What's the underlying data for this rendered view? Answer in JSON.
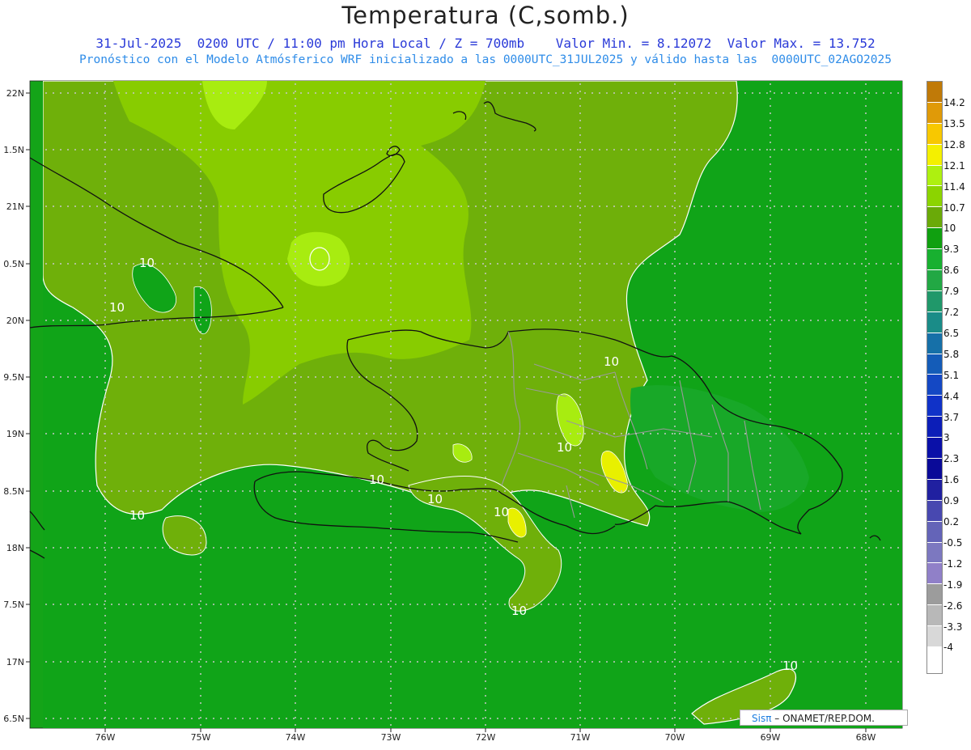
{
  "title": "Temperatura (C,somb.)",
  "subtitle1": "31-Jul-2025  0200 UTC / 11:00 pm Hora Local / Z = 700mb    Valor Min. = 8.12072  Valor Max. = 13.752",
  "subtitle2": "Pronóstico con el Modelo Atmósferico WRF inicializado a las 0000UTC_31JUL2025 y válido hasta las  0000UTC_02AGO2025",
  "lat_labels": [
    "22N",
    "1.5N",
    "21N",
    "0.5N",
    "20N",
    "9.5N",
    "19N",
    "8.5N",
    "18N",
    "7.5N",
    "17N",
    "6.5N"
  ],
  "lon_labels": [
    "76W",
    "75W",
    "74W",
    "73W",
    "72W",
    "71W",
    "70W",
    "69W",
    "68W"
  ],
  "colorbar": {
    "labels": [
      "14.2",
      "13.5",
      "12.8",
      "12.1",
      "11.4",
      "10.7",
      "10",
      "9.3",
      "8.6",
      "7.9",
      "7.2",
      "6.5",
      "5.8",
      "5.1",
      "4.4",
      "3.7",
      "3",
      "2.3",
      "1.6",
      "0.9",
      "0.2",
      "-0.5",
      "-1.2",
      "-1.9",
      "-2.6",
      "-3.3",
      "-4"
    ],
    "colors": [
      "#c07a08",
      "#e09a08",
      "#f8c800",
      "#f4f000",
      "#aef010",
      "#8cd400",
      "#6aaa08",
      "#10a010",
      "#18b030",
      "#22a844",
      "#20986a",
      "#1a8c88",
      "#1670a8",
      "#145cb8",
      "#1448c4",
      "#1032c8",
      "#0c1eb8",
      "#0a10a8",
      "#0a0a98",
      "#2020a0",
      "#4848b0",
      "#6464b8",
      "#7c78c0",
      "#9080c8",
      "#9c9c9c",
      "#b8b8b8",
      "#d8d8d8",
      "#ffffff"
    ]
  },
  "contour_labels": [
    "10",
    "10",
    "10",
    "10",
    "10",
    "10",
    "10",
    "10",
    "10",
    "10"
  ],
  "credit": {
    "brand": "Sisπ",
    "text": "– ONAMET/REP.DOM."
  }
}
